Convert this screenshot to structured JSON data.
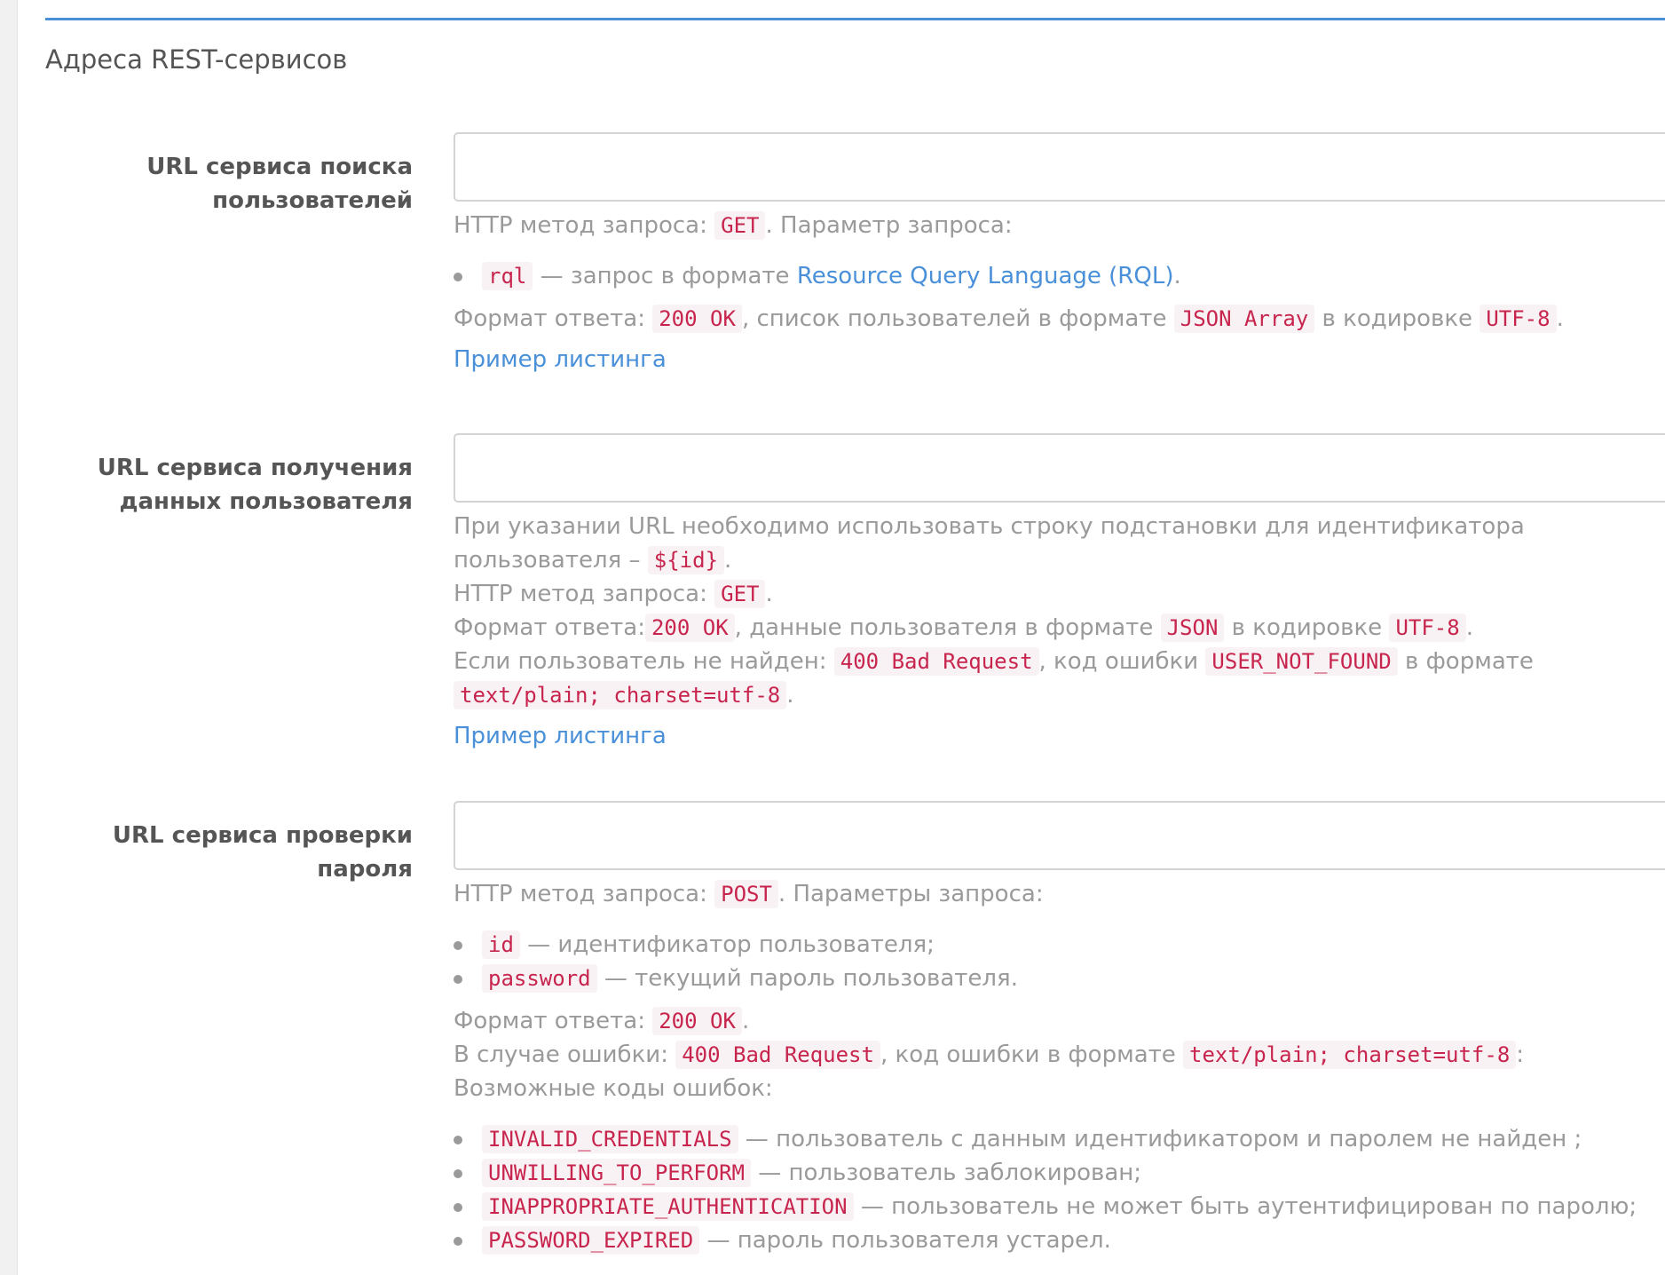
{
  "section": {
    "title": "Адреса REST-сервисов"
  },
  "search_service": {
    "label": "URL сервиса поиска пользователей",
    "input_value": "",
    "method_prefix": "HTTP метод запроса: ",
    "method": "GET",
    "method_suffix": ". Параметр запроса:",
    "params": [
      {
        "code": "rql",
        "desc_prefix": " — запрос в формате ",
        "link_text": "Resource Query Language (RQL)",
        "desc_suffix": "."
      }
    ],
    "response_prefix": "Формат ответа: ",
    "response_status": "200 OK",
    "response_mid1": ", список пользователей в формате ",
    "response_format": "JSON Array",
    "response_mid2": " в кодировке ",
    "response_encoding": "UTF-8",
    "response_end": ".",
    "listing_link": "Пример листинга"
  },
  "user_data_service": {
    "label": "URL сервиса получения данных пользователя",
    "input_value": "",
    "note_text": "При указании URL необходимо использовать строку подстановки для идентификатора пользователя – ",
    "note_code": "${id}",
    "note_end": ".",
    "method_prefix": "HTTP метод запроса: ",
    "method": "GET",
    "method_end": ".",
    "response_prefix": "Формат ответа:",
    "response_status": "200 OK",
    "response_mid1": ", данные пользователя в формате ",
    "response_format": "JSON",
    "response_mid2": " в кодировке ",
    "response_encoding": "UTF-8",
    "response_end": ".",
    "notfound_prefix": "Если пользователь не найден: ",
    "notfound_status": "400 Bad Request",
    "notfound_mid1": ", код ошибки ",
    "notfound_code": "USER_NOT_FOUND",
    "notfound_mid2": " в формате ",
    "notfound_format": "text/plain; charset=utf-8",
    "notfound_end": ".",
    "listing_link": "Пример листинга"
  },
  "password_service": {
    "label": "URL сервиса проверки пароля",
    "input_value": "",
    "method_prefix": "HTTP метод запроса: ",
    "method": "POST",
    "method_suffix": ". Параметры запроса:",
    "params": [
      {
        "code": "id",
        "desc": " — идентификатор пользователя;"
      },
      {
        "code": "password",
        "desc": " — текущий пароль пользователя."
      }
    ],
    "response_prefix": "Формат ответа: ",
    "response_status": "200 OK",
    "response_end": ".",
    "error_prefix": "В случае ошибки: ",
    "error_status": "400 Bad Request",
    "error_mid": ", код ошибки в формате ",
    "error_format": "text/plain; charset=utf-8",
    "error_end": ":",
    "codes_heading": "Возможные коды ошибок:",
    "error_codes": [
      {
        "code": "INVALID_CREDENTIALS",
        "desc": " — пользователь с данным идентификатором и паролем не найден ;"
      },
      {
        "code": "UNWILLING_TO_PERFORM",
        "desc": " — пользователь заблокирован;"
      },
      {
        "code": "INAPPROPRIATE_AUTHENTICATION",
        "desc": " — пользователь не может быть аутентифицирован по паролю;"
      },
      {
        "code": "PASSWORD_EXPIRED",
        "desc": " — пароль пользователя устарел."
      }
    ]
  }
}
